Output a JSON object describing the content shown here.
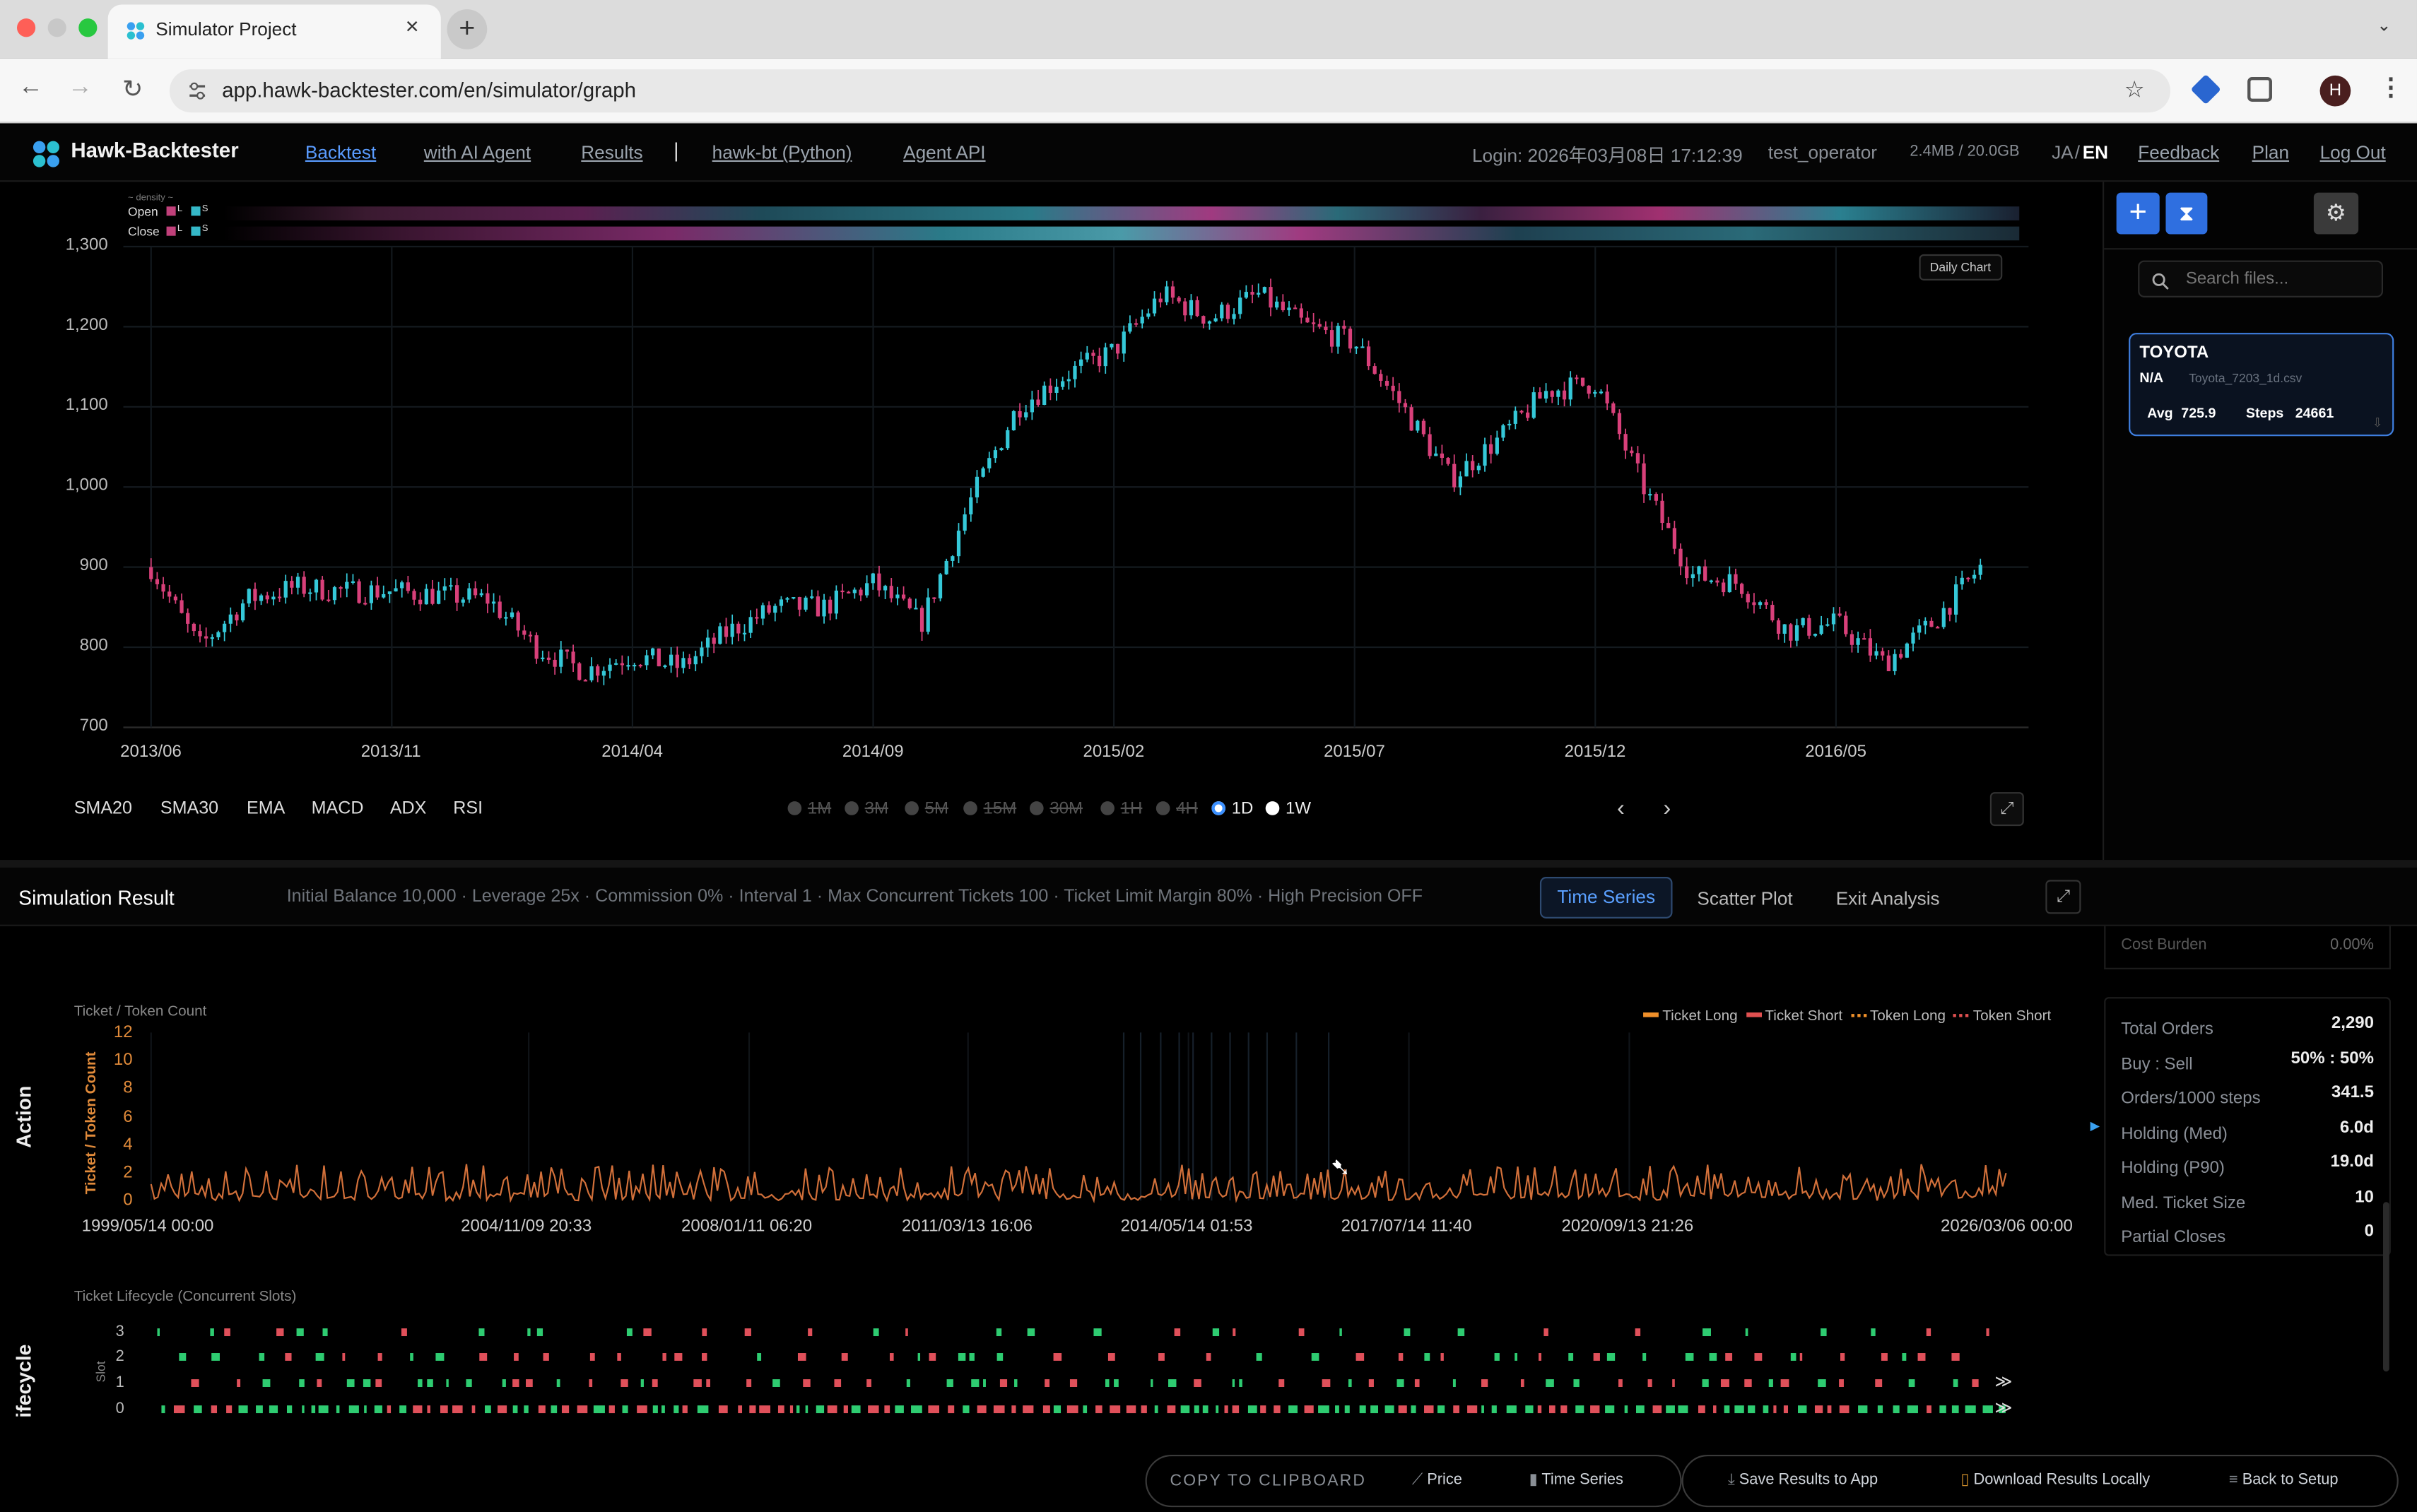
{
  "browser": {
    "tab_title": "Simulator Project",
    "url": "app.hawk-backtester.com/en/simulator/graph",
    "avatar_letter": "H"
  },
  "app": {
    "name": "Hawk-Backtester",
    "nav": [
      "Backtest",
      "with AI Agent",
      "Results",
      "hawk-bt (Python)",
      "Agent API"
    ],
    "separator": "|",
    "login": "Login: 2026年03月08日 17:12:39",
    "user": "test_operator",
    "storage": "2.4MB / 20.0GB",
    "lang_ja": "JA",
    "lang_sep": "/",
    "lang_en": "EN",
    "feedback": "Feedback",
    "plan": "Plan",
    "logout": "Log Out"
  },
  "density": {
    "title": "density",
    "open_label": "Open",
    "close_label": "Close",
    "long_tag": "L",
    "short_tag": "S"
  },
  "price_chart": {
    "daily_chart_button": "Daily Chart",
    "y_ticks": [
      "1,300",
      "1,200",
      "1,100",
      "1,000",
      "900",
      "800",
      "700"
    ],
    "x_ticks": [
      "2013/06",
      "2013/11",
      "2014/04",
      "2014/09",
      "2015/02",
      "2015/07",
      "2015/12",
      "2016/05"
    ],
    "indicators": [
      "SMA20",
      "SMA30",
      "EMA",
      "MACD",
      "ADX",
      "RSI"
    ],
    "timeframes": [
      "1M",
      "3M",
      "5M",
      "15M",
      "30M",
      "1H",
      "4H",
      "1D",
      "1W"
    ],
    "active_timeframe": "1D"
  },
  "chart_data": [
    {
      "type": "candlestick",
      "ylim": [
        700,
        1300
      ],
      "x_ticks": [
        "2013/06",
        "2013/11",
        "2014/04",
        "2014/09",
        "2015/02",
        "2015/07",
        "2015/12",
        "2016/05"
      ],
      "approx_close": [
        {
          "x": "2013/06",
          "y": 900
        },
        {
          "x": "2013/07",
          "y": 800
        },
        {
          "x": "2013/08",
          "y": 860
        },
        {
          "x": "2013/09",
          "y": 875
        },
        {
          "x": "2013/10",
          "y": 870
        },
        {
          "x": "2013/11",
          "y": 870
        },
        {
          "x": "2014/01",
          "y": 860
        },
        {
          "x": "2014/02",
          "y": 800
        },
        {
          "x": "2014/03",
          "y": 770
        },
        {
          "x": "2014/04",
          "y": 790
        },
        {
          "x": "2014/05",
          "y": 775
        },
        {
          "x": "2014/06",
          "y": 820
        },
        {
          "x": "2014/07",
          "y": 850
        },
        {
          "x": "2014/08",
          "y": 850
        },
        {
          "x": "2014/09",
          "y": 880
        },
        {
          "x": "2014/10",
          "y": 830
        },
        {
          "x": "2014/11",
          "y": 980
        },
        {
          "x": "2014/12",
          "y": 1100
        },
        {
          "x": "2015/01",
          "y": 1140
        },
        {
          "x": "2015/02",
          "y": 1170
        },
        {
          "x": "2015/03",
          "y": 1240
        },
        {
          "x": "2015/04",
          "y": 1210
        },
        {
          "x": "2015/05",
          "y": 1240
        },
        {
          "x": "2015/06",
          "y": 1200
        },
        {
          "x": "2015/07",
          "y": 1180
        },
        {
          "x": "2015/08",
          "y": 1100
        },
        {
          "x": "2015/09",
          "y": 1010
        },
        {
          "x": "2015/10",
          "y": 1060
        },
        {
          "x": "2015/11",
          "y": 1120
        },
        {
          "x": "2015/12",
          "y": 1130
        },
        {
          "x": "2016/01",
          "y": 1000
        },
        {
          "x": "2016/02",
          "y": 890
        },
        {
          "x": "2016/03",
          "y": 880
        },
        {
          "x": "2016/04",
          "y": 820
        },
        {
          "x": "2016/05",
          "y": 830
        },
        {
          "x": "2016/06",
          "y": 780
        },
        {
          "x": "2016/07",
          "y": 830
        },
        {
          "x": "2016/08",
          "y": 900
        }
      ]
    },
    {
      "type": "line",
      "title": "Ticket / Token Count",
      "ylabel": "Ticket / Token Count",
      "y_ticks": [
        "12",
        "10",
        "8",
        "6",
        "4",
        "2",
        "0"
      ],
      "ylim": [
        0,
        12
      ],
      "x_ticks": [
        "1999/05/14 00:00",
        "2004/11/09 20:33",
        "2008/01/11 06:20",
        "2011/03/13 16:06",
        "2014/05/14 01:53",
        "2017/07/14 11:40",
        "2020/09/13 21:26",
        "2026/03/06 00:00"
      ],
      "legend": [
        "Ticket Long",
        "Ticket Short",
        "Token Long",
        "Token Short"
      ]
    },
    {
      "type": "timeline",
      "title": "Ticket Lifecycle (Concurrent Slots)",
      "ylabel": "Slot",
      "y_ticks": [
        "3",
        "2",
        "1",
        "0"
      ]
    }
  ],
  "right_panel": {
    "search_placeholder": "Search files...",
    "file": {
      "name": "TOYOTA",
      "status": "N/A",
      "filename": "Toyota_7203_1d.csv",
      "avg_label": "Avg",
      "avg_value": "725.9",
      "steps_label": "Steps",
      "steps_value": "24661"
    }
  },
  "simulation": {
    "title": "Simulation Result",
    "params": "Initial Balance 10,000 · Leverage 25x · Commission 0% · Interval 1 · Max Concurrent Tickets 100 · Ticket Limit Margin 80% · High Precision OFF",
    "tabs": [
      "Time Series",
      "Scatter Plot",
      "Exit Analysis"
    ],
    "active_tab": "Time Series",
    "section_action": "Action",
    "section_lifecycle": "ifecycle",
    "cost_burden_label": "Cost Burden",
    "cost_burden_value": "0.00%",
    "metrics": [
      {
        "label": "Total Orders",
        "value": "2,290"
      },
      {
        "label": "Buy : Sell",
        "value": "50% : 50%"
      },
      {
        "label": "Orders/1000 steps",
        "value": "341.5"
      },
      {
        "label": "Holding (Med)",
        "value": "6.0d"
      },
      {
        "label": "Holding (P90)",
        "value": "19.0d"
      },
      {
        "label": "Med. Ticket Size",
        "value": "10"
      },
      {
        "label": "Partial Closes",
        "value": "0"
      }
    ]
  },
  "bottom_bar": {
    "copy_label": "COPY TO CLIPBOARD",
    "price": "Price",
    "time_series": "Time Series",
    "save": "Save Results to App",
    "download": "Download Results Locally",
    "back": "Back to Setup"
  },
  "colors": {
    "accent": "#2f6fe0",
    "up": "#35c8d8",
    "down": "#d8407a",
    "long": "#2ecc71",
    "short": "#e0505a",
    "action_line": "#d2703a"
  }
}
